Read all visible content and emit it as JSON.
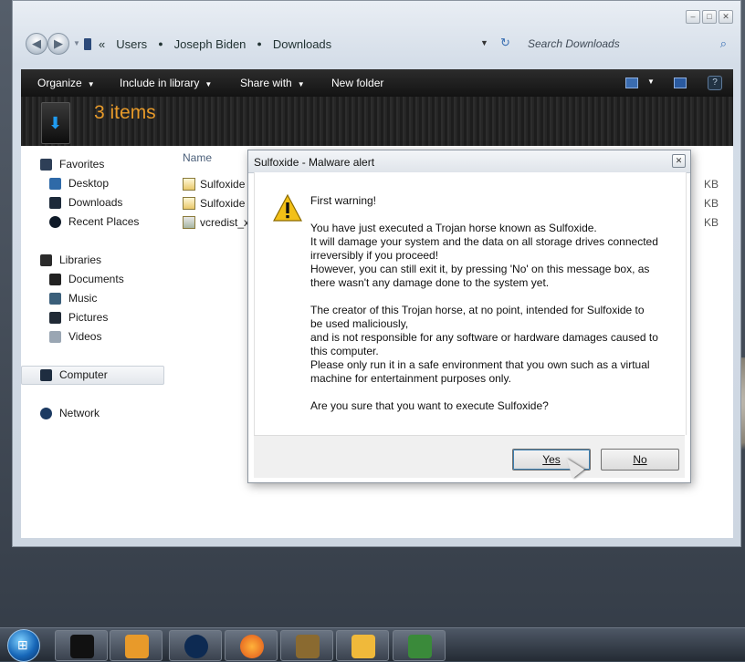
{
  "explorer": {
    "breadcrumb": [
      "Users",
      "Joseph Biden",
      "Downloads"
    ],
    "search_placeholder": "Search Downloads",
    "window_controls": [
      "minimize-icon",
      "maximize-icon",
      "close-icon"
    ],
    "toolbar": {
      "organize": "Organize",
      "include_in_library": "Include in library",
      "share_with": "Share with",
      "new_folder": "New folder"
    },
    "item_count": "3 items",
    "nav": {
      "favorites": "Favorites",
      "desktop": "Desktop",
      "downloads": "Downloads",
      "recent_places": "Recent Places",
      "libraries": "Libraries",
      "documents": "Documents",
      "music": "Music",
      "pictures": "Pictures",
      "videos": "Videos",
      "computer": "Computer",
      "network": "Network"
    },
    "columns": {
      "name": "Name"
    },
    "files": [
      {
        "name": "Sulfoxide",
        "size": "KB"
      },
      {
        "name": "Sulfoxide",
        "size": "KB"
      },
      {
        "name": "vcredist_x",
        "size": "KB"
      }
    ]
  },
  "dialog": {
    "title": "Sulfoxide - Malware alert",
    "icon": "warning-icon",
    "lines": [
      "First warning!",
      "",
      "You have just executed a Trojan horse known as Sulfoxide.",
      "It will damage your system and the data on all storage drives connected",
      "irreversibly if you proceed!",
      "However, you can still exit it, by pressing 'No' on this message box, as",
      "there wasn't any damage done to the system yet.",
      "",
      "The creator of this Trojan horse, at no point, intended for Sulfoxide to",
      "be used maliciously,",
      "and is not responsible for any software or hardware damages caused to",
      "this computer.",
      "Please only run it in a safe environment that you own such as a virtual",
      "machine for entertainment purposes only.",
      "",
      "Are you sure that you want to execute Sulfoxide?"
    ],
    "yes": "Yes",
    "no": "No"
  },
  "taskbar": {
    "items": [
      "explorer-icon",
      "media-player-icon",
      "globe-icon",
      "firefox-icon",
      "vbox-icon",
      "folder-window-icon",
      "malware-app-icon"
    ]
  },
  "colors": {
    "item_count": "#e79a2a",
    "toolbar_bg": "#1a1a1a",
    "accent_blue": "#3970b5"
  }
}
